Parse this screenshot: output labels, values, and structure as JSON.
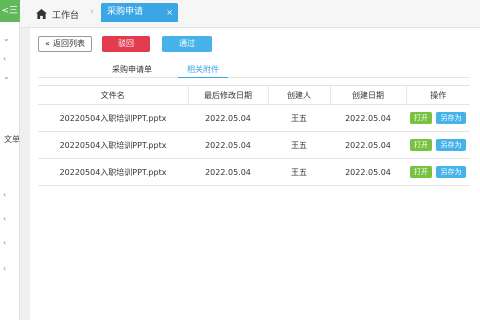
{
  "sidebar": {
    "toggle_label": "<三",
    "partial_text": "文单"
  },
  "topbar": {
    "home_label": "工作台",
    "active_tab": "采购申请",
    "close_glyph": "×",
    "sep_glyph": "‹"
  },
  "toolbar": {
    "back_label": "返回列表",
    "reject_label": "驳回",
    "pass_label": "通过"
  },
  "subtabs": {
    "tab1": "采购申请单",
    "tab2": "相关附件"
  },
  "table": {
    "headers": [
      "文件名",
      "最后修改日期",
      "创建人",
      "创建日期",
      "操作"
    ],
    "rows": [
      {
        "filename": "20220504入职培训PPT.pptx",
        "modified": "2022.05.04",
        "creator": "王五",
        "created": "2022.05.04",
        "open": "打开",
        "save": "另存为"
      },
      {
        "filename": "20220504入职培训PPT.pptx",
        "modified": "2022.05.04",
        "creator": "王五",
        "created": "2022.05.04",
        "open": "打开",
        "save": "另存为"
      },
      {
        "filename": "20220504入职培训PPT.pptx",
        "modified": "2022.05.04",
        "creator": "王五",
        "created": "2022.05.04",
        "open": "打开",
        "save": "另存为"
      }
    ]
  },
  "colors": {
    "accent": "#3aa6e6",
    "danger": "#e23c4f",
    "success": "#7ac142",
    "sidebar_toggle": "#5fb85a"
  },
  "icons": [
    "home-icon",
    "double-chevron-left-icon",
    "chevron-down-icon",
    "chevron-left-icon",
    "close-icon"
  ]
}
